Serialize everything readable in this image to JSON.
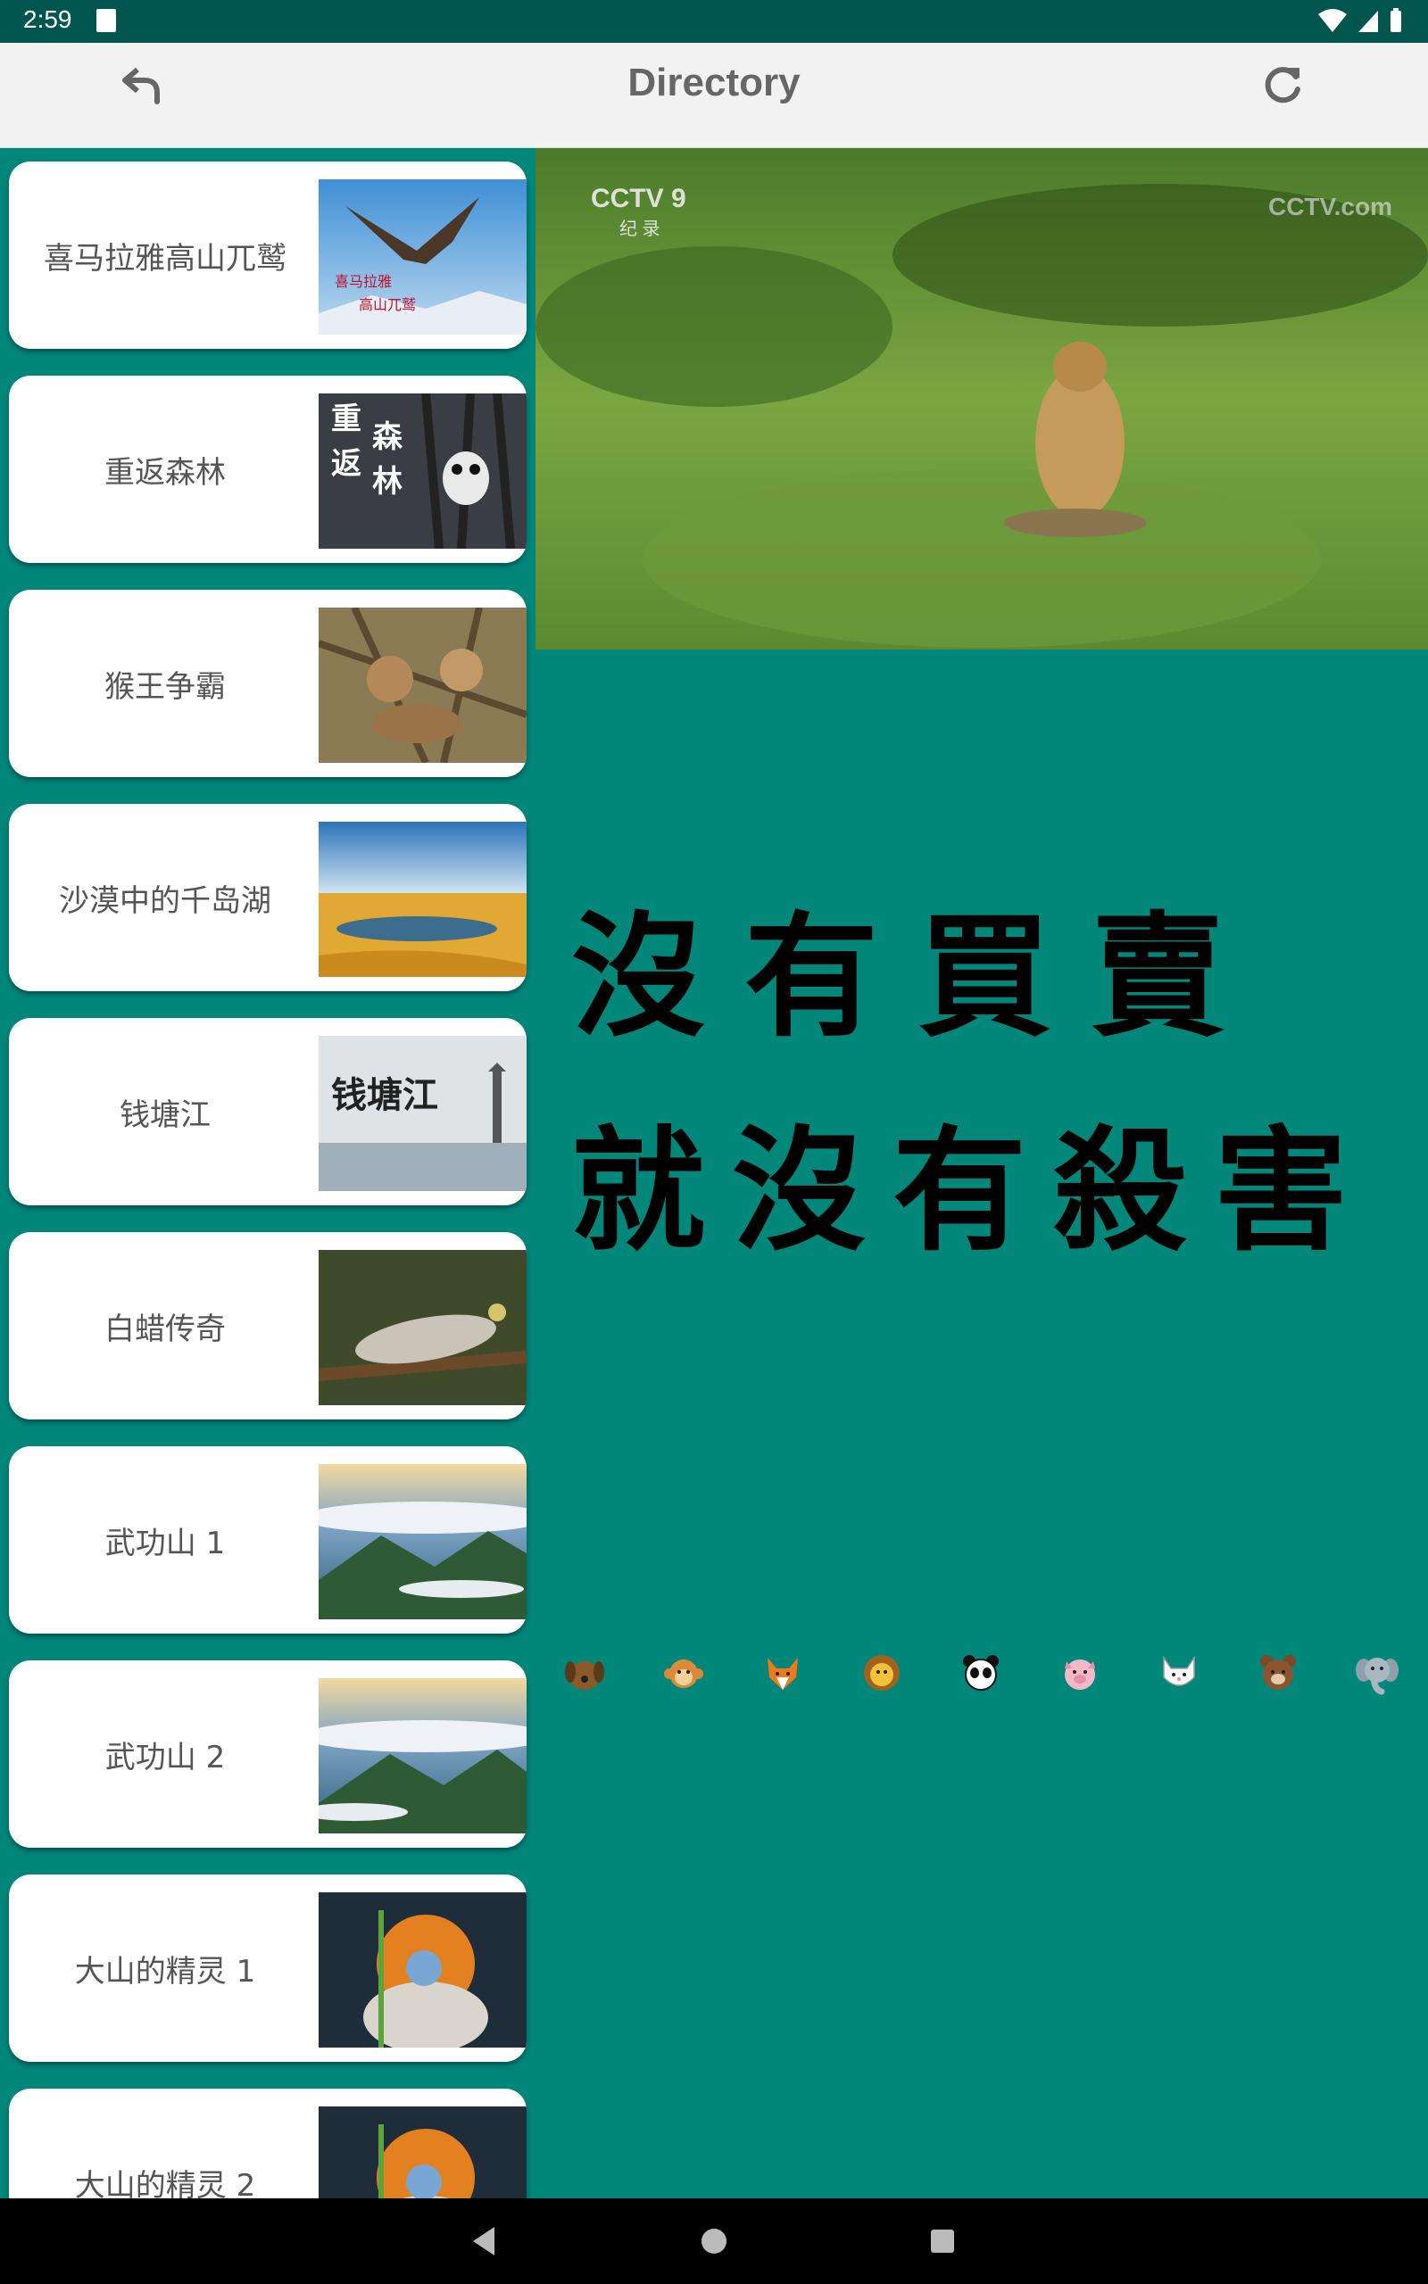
{
  "status_bar": {
    "time": "2:59"
  },
  "app_bar": {
    "title": "Directory",
    "back_icon": "back-arrow-icon",
    "refresh_icon": "refresh-icon"
  },
  "directory": {
    "items": [
      {
        "label": "喜马拉雅高山兀鹫",
        "thumb_text": "喜马拉雅\n高山兀鹫"
      },
      {
        "label": "重返森林",
        "thumb_text": "重返森林"
      },
      {
        "label": "猴王争霸"
      },
      {
        "label": "沙漠中的千岛湖"
      },
      {
        "label": "钱塘江",
        "thumb_text": "钱塘江"
      },
      {
        "label": "白蜡传奇"
      },
      {
        "label": "武功山 1"
      },
      {
        "label": "武功山 2"
      },
      {
        "label": "大山的精灵 1"
      },
      {
        "label": "大山的精灵 2"
      }
    ]
  },
  "video": {
    "channel_logo": "CCTV 9",
    "channel_sub": "纪 录",
    "watermark": "CCTV.com"
  },
  "slogan": {
    "line1": "沒有買賣",
    "line2": "就沒有殺害"
  },
  "animal_bar": {
    "icons": [
      "dog-icon",
      "monkey-icon",
      "fox-icon",
      "lion-icon",
      "panda-icon",
      "pig-icon",
      "cat-icon",
      "bear-icon",
      "elephant-icon"
    ]
  }
}
